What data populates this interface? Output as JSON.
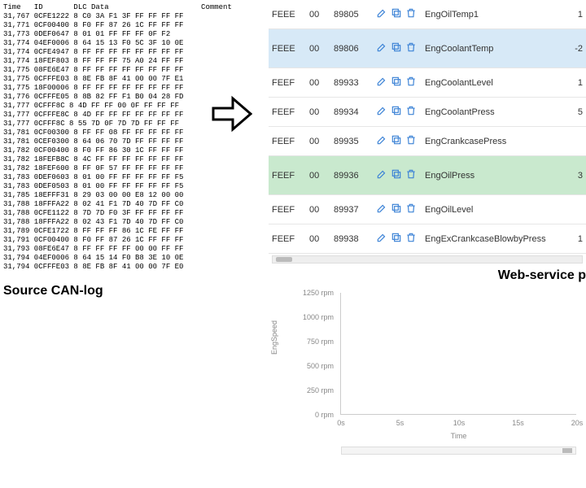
{
  "canlog": {
    "header": "Time   ID       DLC Data                     Comment",
    "lines": [
      "31,767 0CFE1222 8 C0 3A F1 3F FF FF FF FF",
      "31,771 0CF00400 8 F0 FF 87 26 1C FF FF FF",
      "31,773 0DEF0647 8 01 01 FF FF FF 0F F2",
      "31,774 04EF0006 8 64 15 13 F0 5C 3F 10 0E",
      "31,774 0CFE4947 8 FF FF FF FF FF FF FF FF",
      "31,774 18FEF803 8 FF FF FF 75 A0 24 FF FF",
      "31,775 08FE6E47 8 FF FF FF FF FF FF FF FF",
      "31,775 0CFFFE03 8 8E FB 8F 41 00 00 7F E1",
      "31,775 18F00006 8 FF FF FF FF FF FF FF FF",
      "31,776 0CFFFE05 8 8B 82 FF F1 B0 04 28 FD",
      "31,777 0CFFF8C 8 4D FF FF 00 0F FF FF FF",
      "31,777 0CFFFE8C 8 4D FF FF FF FF FF FF FF",
      "31,777 0CFFF8C 8 55 7D 0F 7D 7D FF FF FF",
      "31,781 0CF00300 8 FF FF 08 FF FF FF FF FF",
      "31,781 0CEF0300 8 64 06 70 7D FF FF FF FF",
      "31,782 0CF00400 8 F0 FF 86 30 1C FF FF FF",
      "31,782 18FEFB8C 8 4C FF FF FF FF FF FF FF",
      "31,782 18FEF600 8 FF 0F 57 FF FF FF FF FF",
      "31,783 0DEF0603 8 01 00 FF FF FF FF FF F5",
      "31,783 0DEF0503 8 01 00 FF FF FF FF FF F5",
      "31,785 18EFFF31 8 29 03 00 00 E8 12 00 00",
      "31,788 18FFFA22 8 02 41 F1 7D 40 7D FF C0",
      "31,788 0CFE1122 8 7D 7D F0 3F FF FF FF FF",
      "31,788 18FFFA22 8 02 43 F1 7D 40 7D FF C0",
      "31,789 0CFE1722 8 FF FF FF 86 1C FE FF FF",
      "31,791 0CF00400 8 F0 FF 87 26 1C FF FF FF",
      "31,793 08FE6E47 8 FF FF FF FF 00 00 FF FF",
      "31,794 04EF0006 8 64 15 14 F0 B8 3E 10 0E",
      "31,794 0CFFFE03 8 8E FB 8F 41 00 00 7F E0"
    ]
  },
  "caption_left": "Source CAN-log",
  "caption_right": "Web-service p",
  "table_rows": [
    {
      "pgn": "FEEE",
      "dlc": "00",
      "id": "89805",
      "name": "EngOilTemp1",
      "val": "1",
      "cls": ""
    },
    {
      "pgn": "FEEE",
      "dlc": "00",
      "id": "89806",
      "name": "EngCoolantTemp",
      "val": "-2",
      "cls": "blue tall"
    },
    {
      "pgn": "FEEF",
      "dlc": "00",
      "id": "89933",
      "name": "EngCoolantLevel",
      "val": "1",
      "cls": ""
    },
    {
      "pgn": "FEEF",
      "dlc": "00",
      "id": "89934",
      "name": "EngCoolantPress",
      "val": "5",
      "cls": ""
    },
    {
      "pgn": "FEEF",
      "dlc": "00",
      "id": "89935",
      "name": "EngCrankcasePress",
      "val": "",
      "cls": ""
    },
    {
      "pgn": "FEEF",
      "dlc": "00",
      "id": "89936",
      "name": "EngOilPress",
      "val": "3",
      "cls": "green tall"
    },
    {
      "pgn": "FEEF",
      "dlc": "00",
      "id": "89937",
      "name": "EngOilLevel",
      "val": "",
      "cls": ""
    },
    {
      "pgn": "FEEF",
      "dlc": "00",
      "id": "89938",
      "name": "EngExCrankcaseBlowbyPress",
      "val": "1",
      "cls": ""
    }
  ],
  "action_icons": {
    "edit": "edit-icon",
    "copy": "copy-icon",
    "delete": "trash-icon"
  },
  "chart_data": {
    "type": "line",
    "title": "",
    "xlabel": "Time",
    "ylabel": "EngSpeed",
    "yunit": "rpm",
    "ylim": [
      0,
      1250
    ],
    "yticks": [
      0,
      250,
      500,
      750,
      1000,
      1250
    ],
    "xticks": [
      "0s",
      "5s",
      "10s",
      "15s",
      "20s"
    ],
    "series": [
      {
        "name": "EngSpeed",
        "x": [],
        "values": []
      }
    ]
  }
}
